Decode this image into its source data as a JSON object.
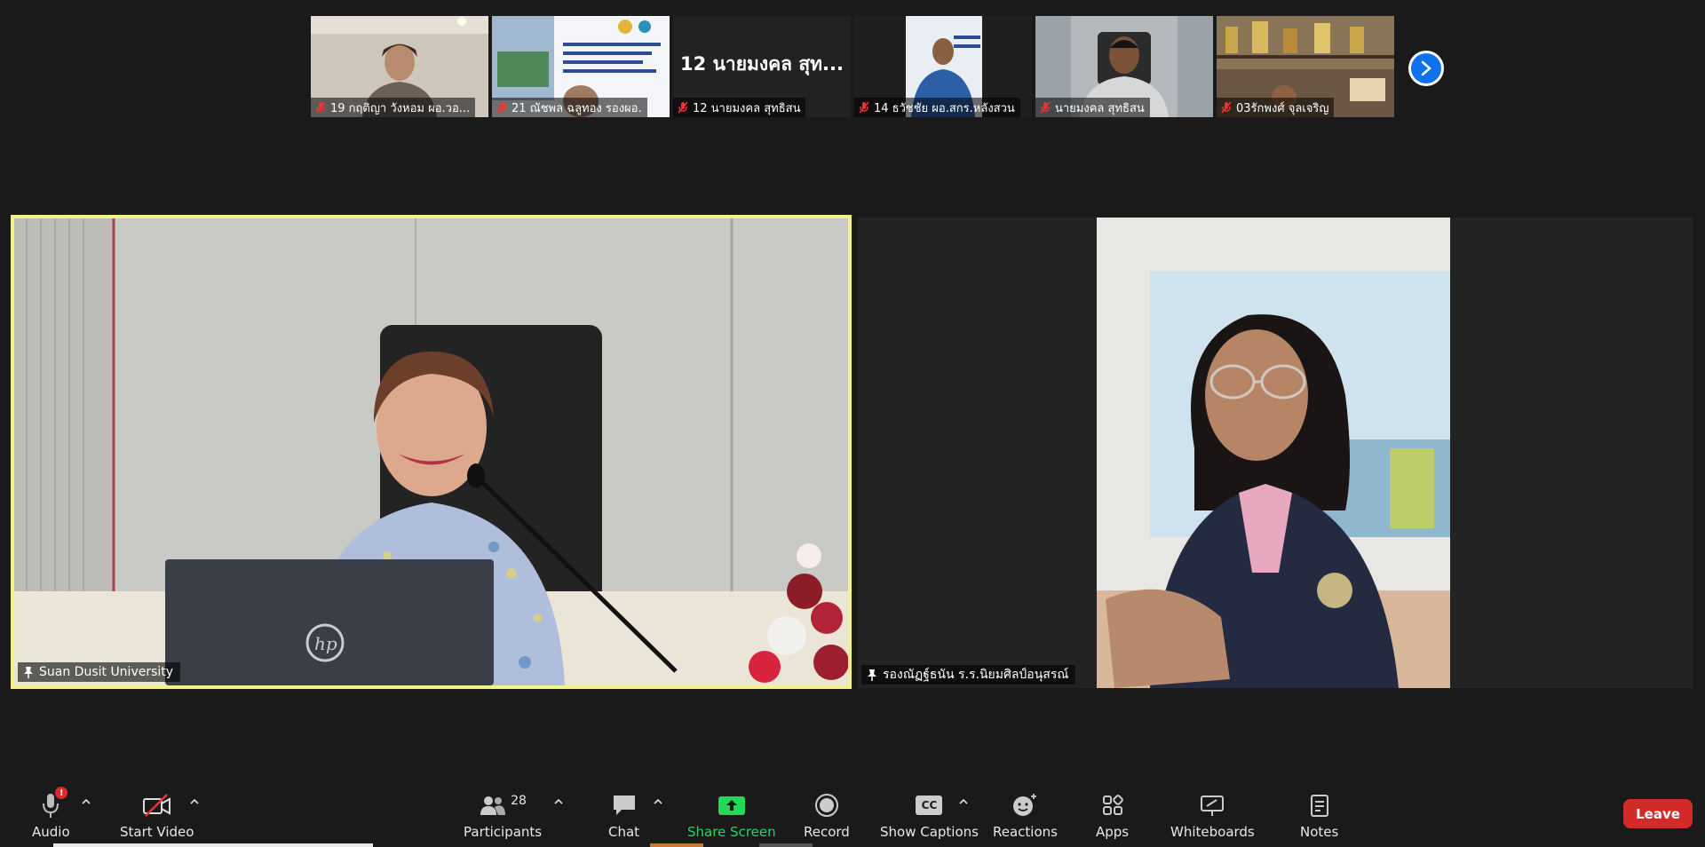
{
  "filmstrip": {
    "participants": [
      {
        "name": "19 กฤติญา วังหอม ผอ.วอ...",
        "muted": true
      },
      {
        "name": "21 ณัชพล ฉลูทอง รองผอ.",
        "muted": true
      },
      {
        "name": "12 นายมงคล สุทธิสน",
        "muted": true,
        "no_video_title": "12 นายมงคล สุท..."
      },
      {
        "name": "14 ธวัชชัย ผอ.สกร.หลังสวน",
        "muted": true
      },
      {
        "name": "นายมงคล สุทธิสน",
        "muted": true
      },
      {
        "name": "03รักพงศ์ จุลเจริญ",
        "muted": true
      }
    ]
  },
  "main": {
    "speaker": {
      "name": "Suan Dusit University",
      "pinned": true,
      "active_speaker_color": "#f4f08a"
    },
    "second": {
      "name": "รองณัฏฐ์ธนัน ร.ร.นิยมศิลป์อนุสรณ์",
      "pinned": true
    }
  },
  "toolbar": {
    "audio": {
      "label": "Audio",
      "badge": "!"
    },
    "video": {
      "label": "Start Video"
    },
    "participants": {
      "label": "Participants",
      "count": "28"
    },
    "chat": {
      "label": "Chat"
    },
    "share": {
      "label": "Share Screen",
      "color": "#23d959"
    },
    "record": {
      "label": "Record"
    },
    "captions": {
      "label": "Show Captions",
      "icon_text": "CC"
    },
    "reactions": {
      "label": "Reactions"
    },
    "apps": {
      "label": "Apps"
    },
    "whiteboards": {
      "label": "Whiteboards"
    },
    "notes": {
      "label": "Notes"
    },
    "leave": {
      "label": "Leave",
      "color": "#d32a2a"
    }
  }
}
